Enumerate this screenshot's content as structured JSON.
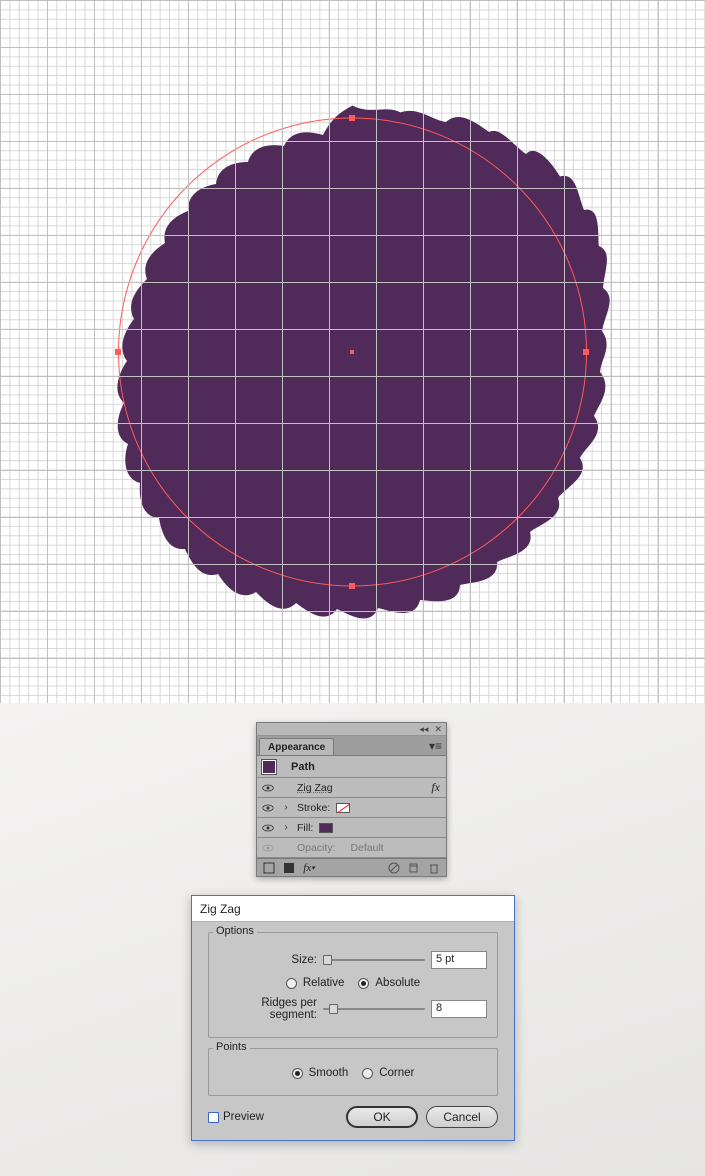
{
  "shape": {
    "fill": "#502a59"
  },
  "appearance": {
    "panel_title": "Appearance",
    "target_label": "Path",
    "rows": {
      "effect_label": "Zig Zag",
      "stroke_label": "Stroke:",
      "fill_label": "Fill:",
      "opacity_label": "Opacity:",
      "opacity_value": "Default"
    },
    "fx_label": "fx"
  },
  "dialog": {
    "title": "Zig Zag",
    "options_legend": "Options",
    "size_label": "Size:",
    "size_value": "5 pt",
    "mode_relative": "Relative",
    "mode_absolute": "Absolute",
    "mode_selected": "absolute",
    "ridges_label": "Ridges per segment:",
    "ridges_value": "8",
    "points_legend": "Points",
    "points_smooth": "Smooth",
    "points_corner": "Corner",
    "points_selected": "smooth",
    "preview_label": "Preview",
    "ok_label": "OK",
    "cancel_label": "Cancel"
  }
}
